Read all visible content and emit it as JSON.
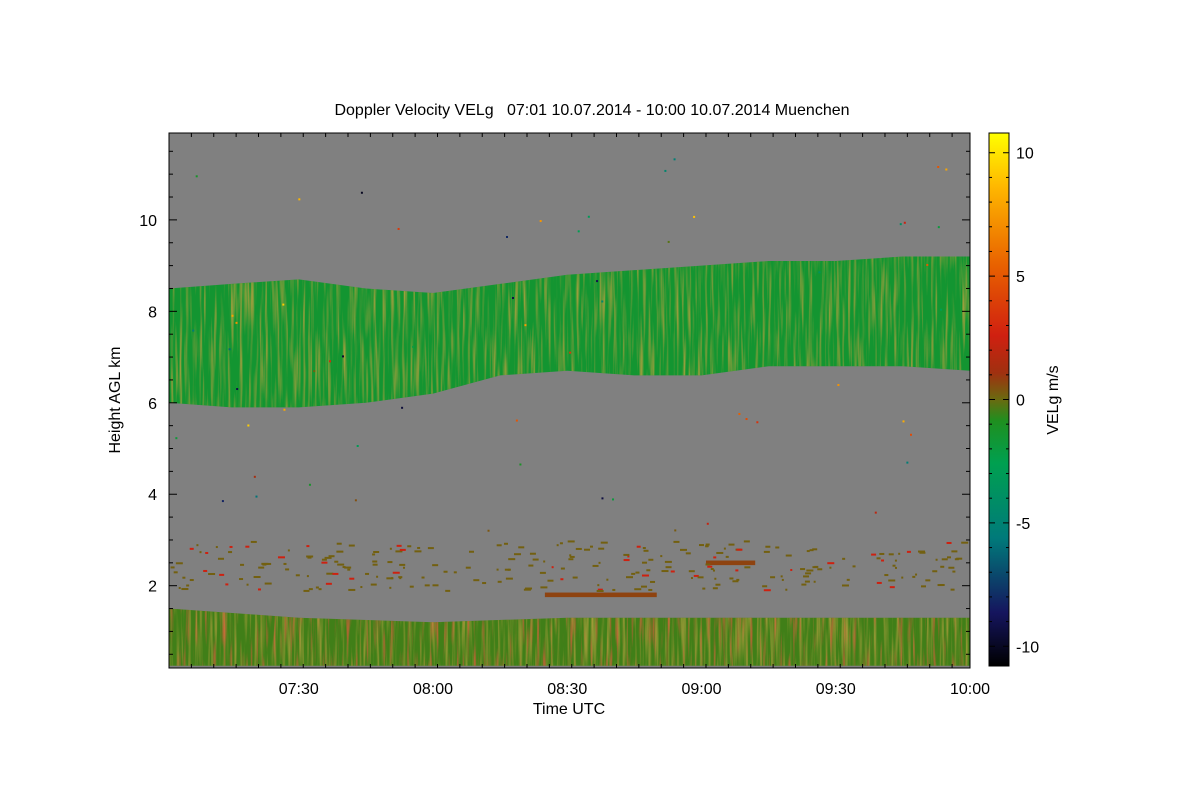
{
  "chart_data": {
    "type": "heatmap",
    "title": "Doppler Velocity VELg   07:01 10.07.2014 - 10:00 10.07.2014 Muenchen",
    "xlabel": "Time UTC",
    "ylabel": "Height AGL km",
    "colorbar_label": "VELg m/s",
    "xlim": [
      "07:01",
      "10:00"
    ],
    "ylim": [
      0.2,
      11.9
    ],
    "x_ticks": [
      "07:30",
      "08:00",
      "08:30",
      "09:00",
      "09:30",
      "10:00"
    ],
    "y_ticks": [
      "2",
      "4",
      "6",
      "8",
      "10"
    ],
    "colorbar_ticks": [
      "10",
      "5",
      "0",
      "-5",
      "-10"
    ],
    "colorbar_range": [
      -10.8,
      10.8
    ],
    "colorscale": [
      "#000000",
      "#1a1a6e",
      "#007f7f",
      "#00a050",
      "#1f8f1f",
      "#6a6a10",
      "#c81e10",
      "#e85a00",
      "#ffb000",
      "#ffff00"
    ],
    "background_color": "#808080",
    "layers": [
      {
        "name": "upper cloud",
        "velocity_mean": -1.5,
        "x": [
          "07:01",
          "07:15",
          "07:30",
          "07:45",
          "08:00",
          "08:15",
          "08:30",
          "08:45",
          "09:00",
          "09:15",
          "09:30",
          "09:45",
          "10:00"
        ],
        "base_km": [
          6.0,
          5.9,
          5.9,
          6.0,
          6.2,
          6.6,
          6.7,
          6.6,
          6.6,
          6.8,
          6.8,
          6.8,
          6.7
        ],
        "top_km": [
          8.5,
          8.6,
          8.7,
          8.5,
          8.4,
          8.6,
          8.8,
          8.9,
          9.0,
          9.1,
          9.1,
          9.2,
          9.2
        ]
      },
      {
        "name": "boundary layer",
        "velocity_mean": -0.5,
        "x": [
          "07:01",
          "07:30",
          "08:00",
          "08:30",
          "09:00",
          "09:30",
          "10:00"
        ],
        "base_km": [
          0.25,
          0.25,
          0.25,
          0.25,
          0.25,
          0.25,
          0.25
        ],
        "top_km": [
          1.5,
          1.3,
          1.2,
          1.3,
          1.3,
          1.3,
          1.3
        ]
      },
      {
        "name": "thin layer",
        "velocity_mean": 0.8,
        "x": [
          "08:25",
          "08:50"
        ],
        "base_km": [
          1.75,
          1.75
        ],
        "top_km": [
          1.85,
          1.85
        ]
      },
      {
        "name": "thin layer 2",
        "velocity_mean": 0.8,
        "x": [
          "09:01",
          "09:12"
        ],
        "base_km": [
          2.45,
          2.45
        ],
        "top_km": [
          2.55,
          2.55
        ]
      }
    ]
  }
}
